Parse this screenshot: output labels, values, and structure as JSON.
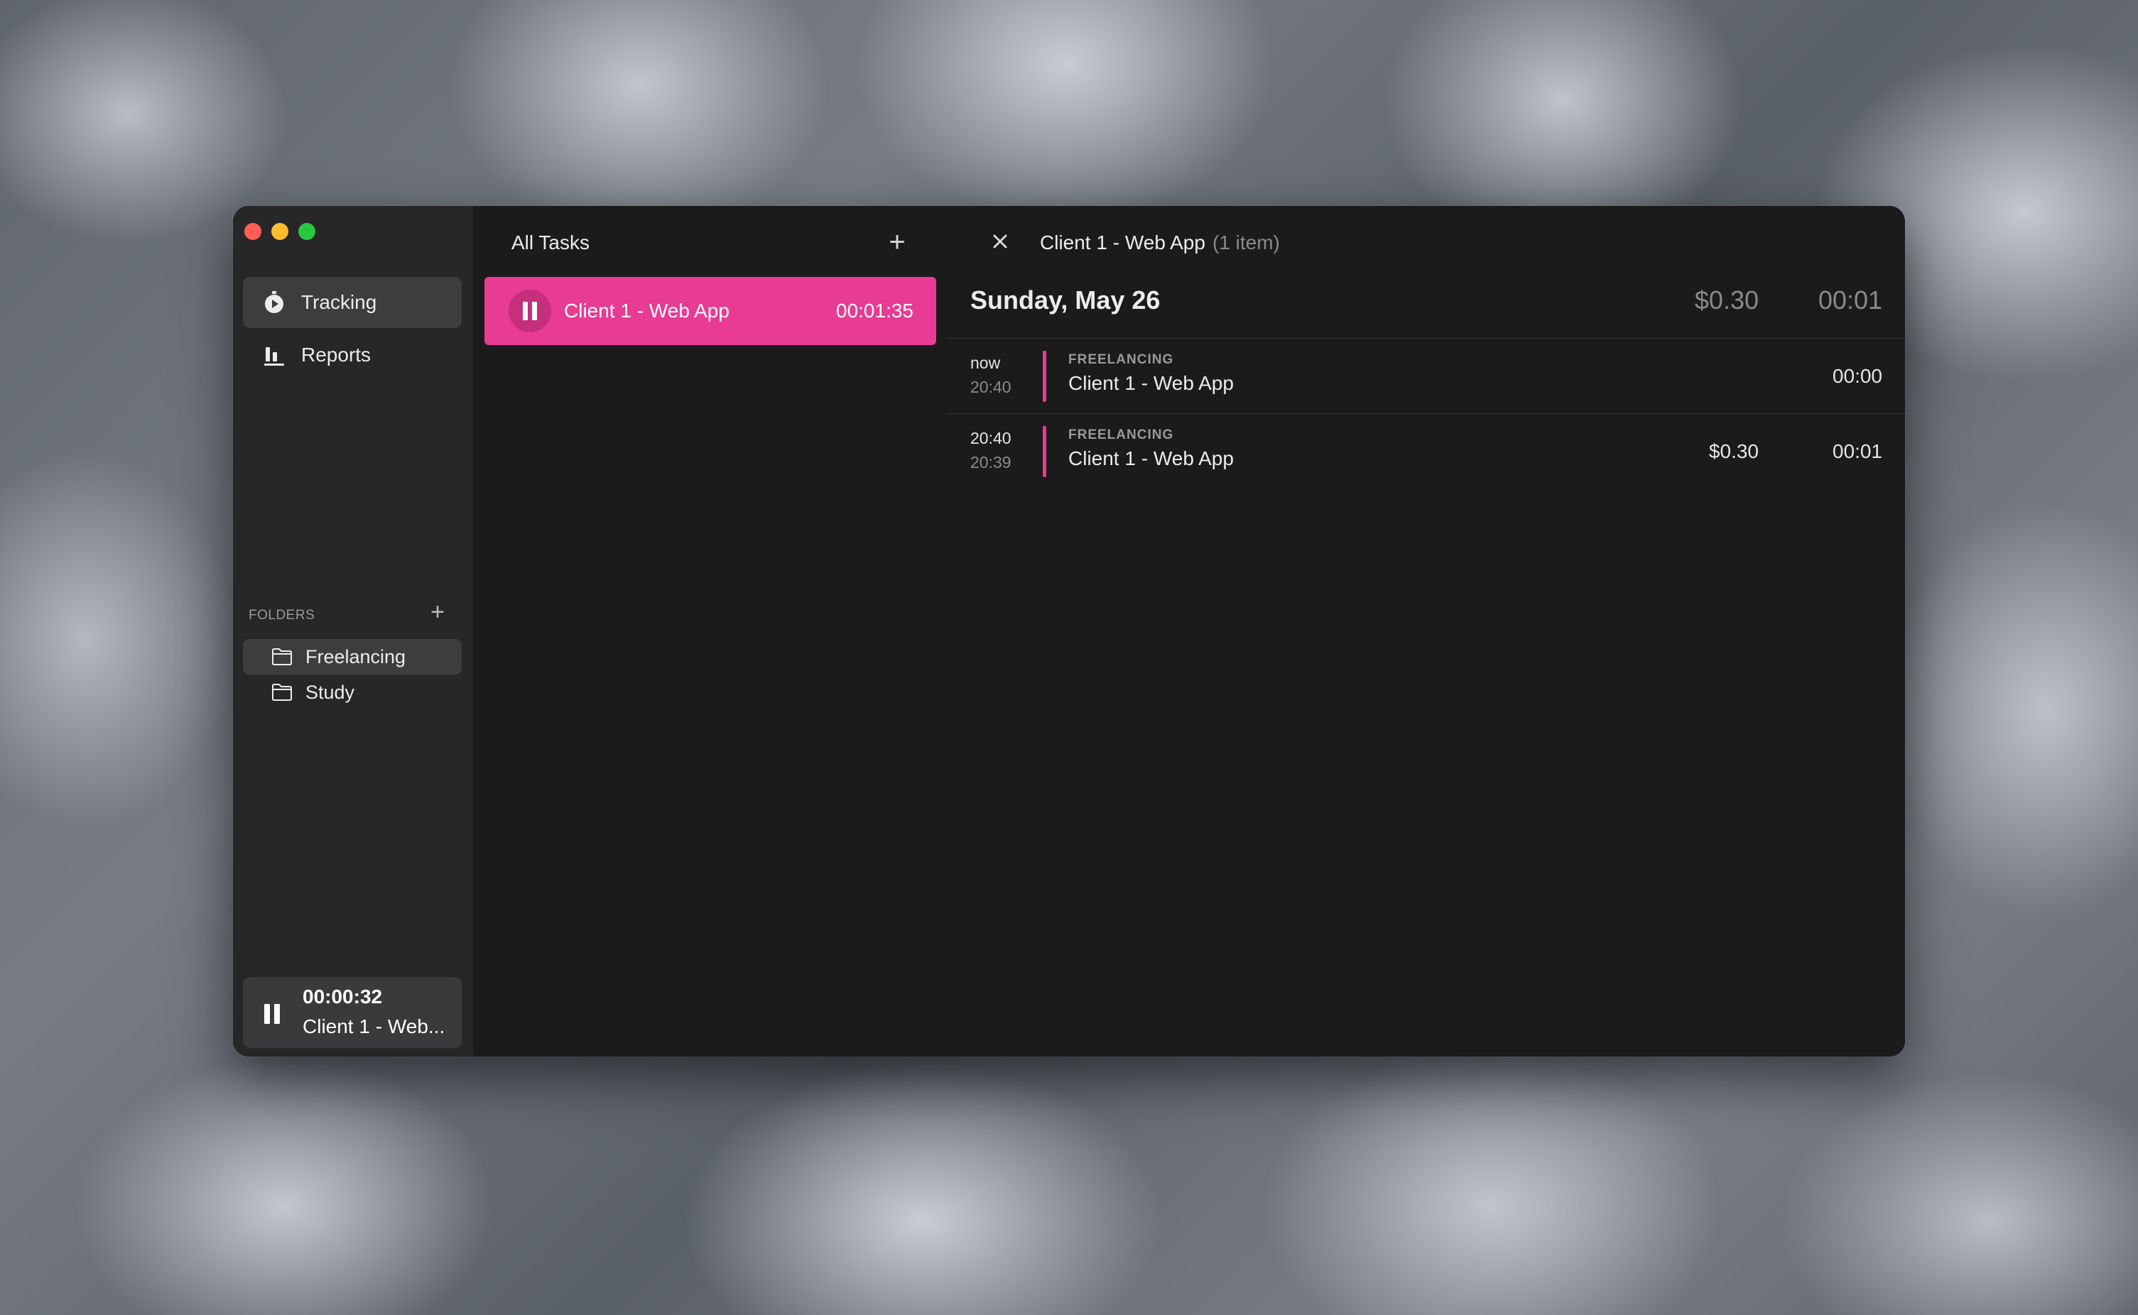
{
  "window": {
    "sidebar": {
      "nav": [
        {
          "label": "Tracking",
          "icon": "stopwatch-icon",
          "active": true
        },
        {
          "label": "Reports",
          "icon": "bar-chart-icon",
          "active": false
        }
      ],
      "folders_label": "FOLDERS",
      "folders": [
        {
          "label": "Freelancing",
          "icon": "folder-icon",
          "active": true
        },
        {
          "label": "Study",
          "icon": "folder-icon",
          "active": false
        }
      ],
      "mini_player": {
        "time": "00:00:32",
        "task": "Client 1 - Web..."
      }
    },
    "tasks": {
      "title": "All Tasks",
      "items": [
        {
          "name": "Client 1 - Web App",
          "time": "00:01:35"
        }
      ]
    },
    "detail": {
      "title": "Client 1 - Web App",
      "count": "(1 item)",
      "day": {
        "label": "Sunday, May 26",
        "amount": "$0.30",
        "duration": "00:01"
      },
      "entries": [
        {
          "start": "now",
          "end": "20:40",
          "folder": "FREELANCING",
          "task": "Client 1 - Web App",
          "amount": "",
          "duration": "00:00"
        },
        {
          "start": "20:40",
          "end": "20:39",
          "folder": "FREELANCING",
          "task": "Client 1 - Web App",
          "amount": "$0.30",
          "duration": "00:01"
        }
      ]
    }
  },
  "colors": {
    "accent": "#e83b93",
    "sidebar_bg": "#272728",
    "content_bg": "#1b1b1c"
  }
}
